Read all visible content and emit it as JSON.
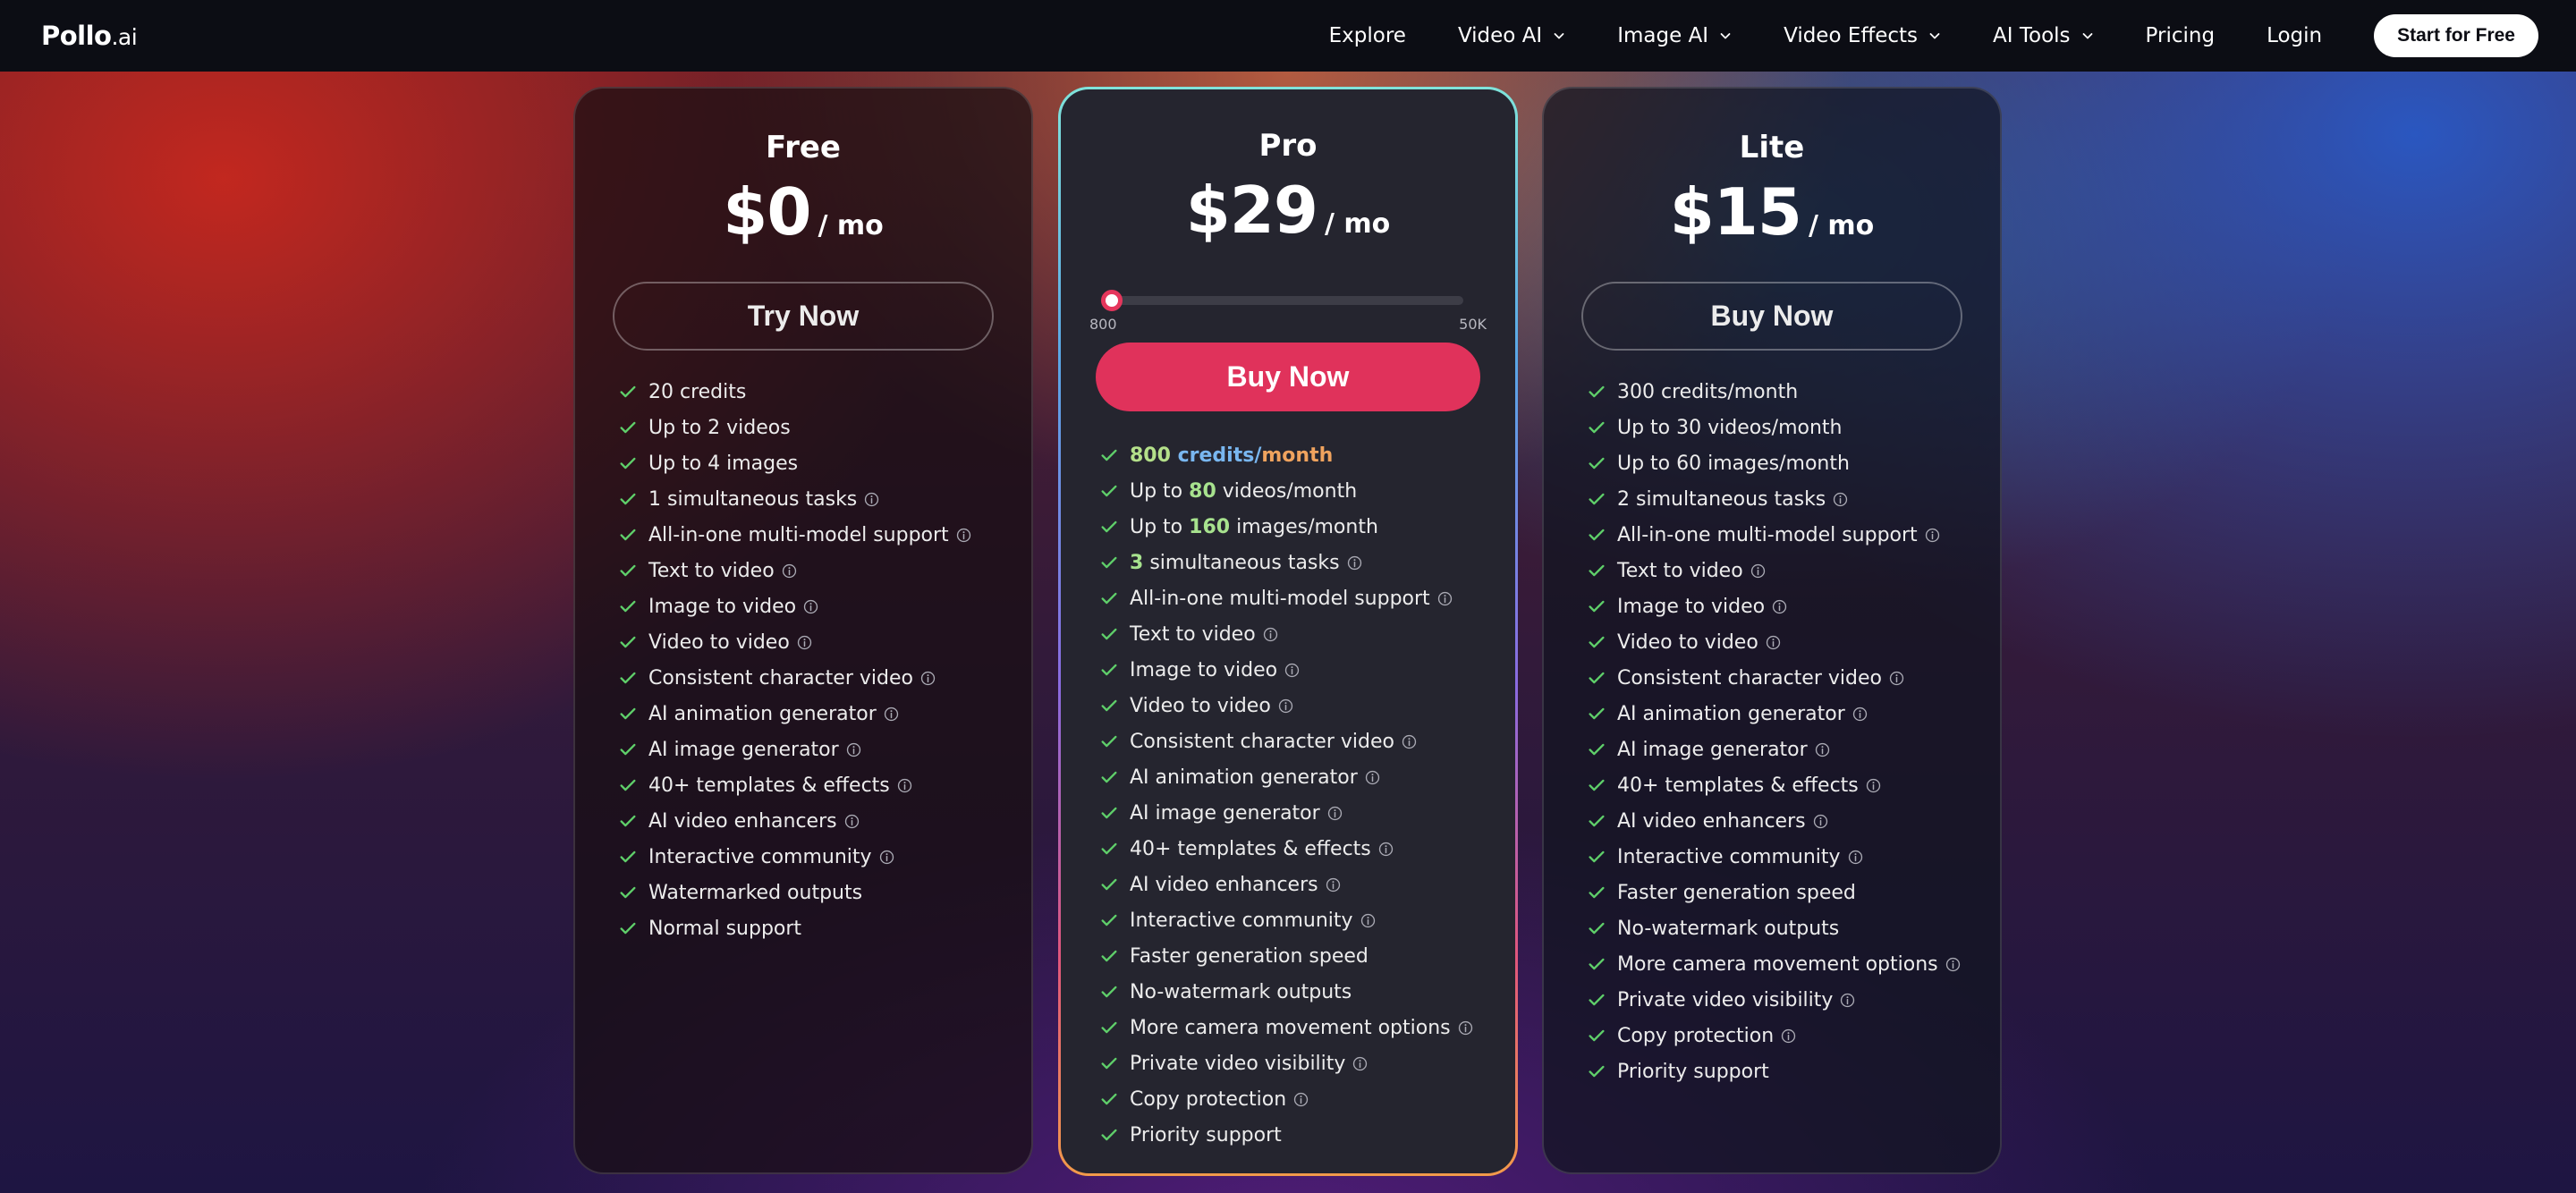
{
  "header": {
    "logo_main": "Pollo",
    "logo_ext": ".ai",
    "nav": [
      {
        "label": "Explore",
        "dropdown": false
      },
      {
        "label": "Video AI",
        "dropdown": true
      },
      {
        "label": "Image AI",
        "dropdown": true
      },
      {
        "label": "Video Effects",
        "dropdown": true
      },
      {
        "label": "AI Tools",
        "dropdown": true
      },
      {
        "label": "Pricing",
        "dropdown": false
      },
      {
        "label": "Login",
        "dropdown": false
      }
    ],
    "cta": "Start for Free"
  },
  "colors": {
    "accent": "#e0325b",
    "check": "#5fcf6a",
    "header_bg": "#0c0d14"
  },
  "plans": {
    "free": {
      "name": "Free",
      "price": "$0",
      "per": "/ mo",
      "button": "Try Now",
      "features": [
        {
          "text": "20 credits",
          "info": false
        },
        {
          "text": "Up to 2 videos",
          "info": false
        },
        {
          "text": "Up to 4 images",
          "info": false
        },
        {
          "text": "1 simultaneous tasks",
          "info": true
        },
        {
          "text": "All-in-one multi-model support",
          "info": true
        },
        {
          "text": "Text to video",
          "info": true
        },
        {
          "text": "Image to video",
          "info": true
        },
        {
          "text": "Video to video",
          "info": true
        },
        {
          "text": "Consistent character video",
          "info": true
        },
        {
          "text": "AI animation generator",
          "info": true
        },
        {
          "text": "AI image generator",
          "info": true
        },
        {
          "text": "40+ templates & effects",
          "info": true
        },
        {
          "text": "AI video enhancers",
          "info": true
        },
        {
          "text": "Interactive community",
          "info": true
        },
        {
          "text": "Watermarked outputs",
          "info": false
        },
        {
          "text": "Normal support",
          "info": false
        }
      ]
    },
    "pro": {
      "name": "Pro",
      "price": "$29",
      "per": "/ mo",
      "slider_min": "800",
      "slider_max": "50K",
      "slider_level": 0,
      "button": "Buy Now",
      "credits": {
        "num": "800",
        "word": "credits",
        "slash": "/",
        "unit": "month"
      },
      "videos": {
        "pre": "Up to",
        "num": "80",
        "post": "videos/month"
      },
      "images": {
        "pre": "Up to",
        "num": "160",
        "post": "images/month"
      },
      "tasks": {
        "num": "3",
        "post": "simultaneous tasks"
      },
      "features": [
        {
          "text": "All-in-one multi-model support",
          "info": true
        },
        {
          "text": "Text to video",
          "info": true
        },
        {
          "text": "Image to video",
          "info": true
        },
        {
          "text": "Video to video",
          "info": true
        },
        {
          "text": "Consistent character video",
          "info": true
        },
        {
          "text": "AI animation generator",
          "info": true
        },
        {
          "text": "AI image generator",
          "info": true
        },
        {
          "text": "40+ templates & effects",
          "info": true
        },
        {
          "text": "AI video enhancers",
          "info": true
        },
        {
          "text": "Interactive community",
          "info": true
        },
        {
          "text": "Faster generation speed",
          "info": false
        },
        {
          "text": "No-watermark outputs",
          "info": false
        },
        {
          "text": "More camera movement options",
          "info": true
        },
        {
          "text": "Private video visibility",
          "info": true
        },
        {
          "text": "Copy protection",
          "info": true
        },
        {
          "text": "Priority support",
          "info": false
        }
      ]
    },
    "lite": {
      "name": "Lite",
      "price": "$15",
      "per": "/ mo",
      "button": "Buy Now",
      "features": [
        {
          "text": "300 credits/month",
          "info": false
        },
        {
          "text": "Up to 30 videos/month",
          "info": false
        },
        {
          "text": "Up to 60 images/month",
          "info": false
        },
        {
          "text": "2 simultaneous tasks",
          "info": true
        },
        {
          "text": "All-in-one multi-model support",
          "info": true
        },
        {
          "text": "Text to video",
          "info": true
        },
        {
          "text": "Image to video",
          "info": true
        },
        {
          "text": "Video to video",
          "info": true
        },
        {
          "text": "Consistent character video",
          "info": true
        },
        {
          "text": "AI animation generator",
          "info": true
        },
        {
          "text": "AI image generator",
          "info": true
        },
        {
          "text": "40+ templates & effects",
          "info": true
        },
        {
          "text": "AI video enhancers",
          "info": true
        },
        {
          "text": "Interactive community",
          "info": true
        },
        {
          "text": "Faster generation speed",
          "info": false
        },
        {
          "text": "No-watermark outputs",
          "info": false
        },
        {
          "text": "More camera movement options",
          "info": true
        },
        {
          "text": "Private video visibility",
          "info": true
        },
        {
          "text": "Copy protection",
          "info": true
        },
        {
          "text": "Priority support",
          "info": false
        }
      ]
    }
  }
}
